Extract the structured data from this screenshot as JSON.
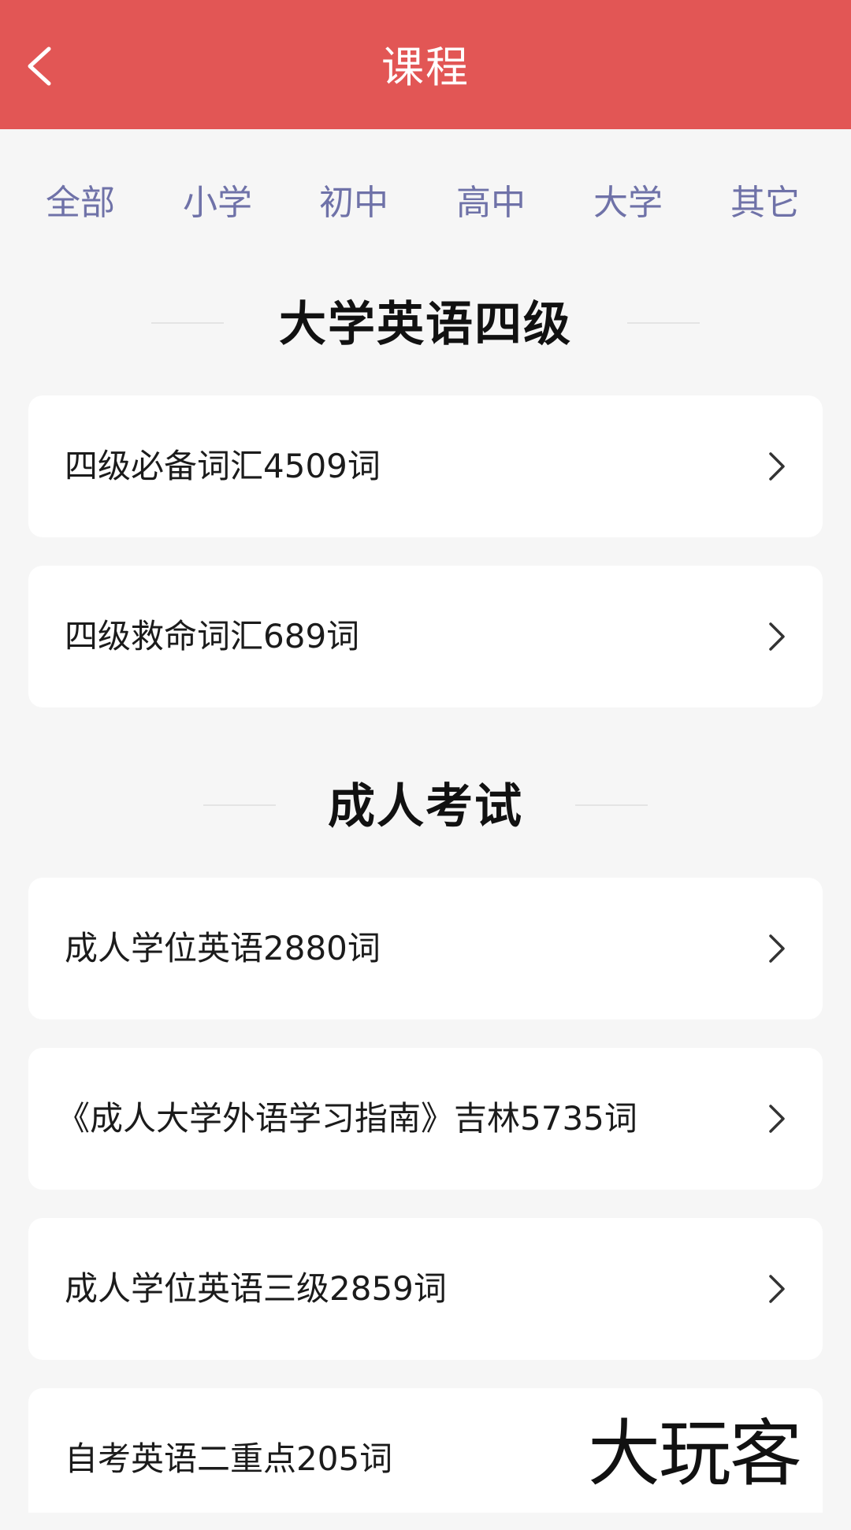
{
  "header": {
    "title": "课程",
    "back_icon": "chevron-left-icon"
  },
  "tabs": [
    {
      "label": "全部"
    },
    {
      "label": "小学"
    },
    {
      "label": "初中"
    },
    {
      "label": "高中"
    },
    {
      "label": "大学"
    },
    {
      "label": "其它"
    }
  ],
  "sections": [
    {
      "title": "大学英语四级",
      "items": [
        {
          "label": "四级必备词汇4509词"
        },
        {
          "label": "四级救命词汇689词"
        }
      ]
    },
    {
      "title": "成人考试",
      "items": [
        {
          "label": "成人学位英语2880词"
        },
        {
          "label": "《成人大学外语学习指南》吉林5735词"
        },
        {
          "label": "成人学位英语三级2859词"
        },
        {
          "label": "自考英语二重点205词"
        }
      ]
    }
  ],
  "watermark": "大玩客",
  "colors": {
    "header_bg": "#e25655",
    "tab_text": "#6f72a8",
    "page_bg": "#f6f6f6",
    "card_bg": "#ffffff"
  }
}
